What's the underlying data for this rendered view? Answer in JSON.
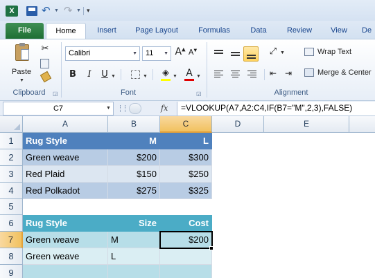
{
  "app": {
    "logo_letter": "X"
  },
  "tabs": [
    "File",
    "Home",
    "Insert",
    "Page Layout",
    "Formulas",
    "Data",
    "Review",
    "View",
    "De"
  ],
  "ribbon": {
    "clipboard": {
      "paste_label": "Paste",
      "group_label": "Clipboard"
    },
    "font": {
      "font_name": "Calibri",
      "font_size": "11",
      "bold": "B",
      "italic": "I",
      "underline": "U",
      "grow": "A",
      "shrink": "A",
      "font_color": "A",
      "group_label": "Font"
    },
    "alignment": {
      "wrap_text": "Wrap Text",
      "merge_center": "Merge & Center",
      "group_label": "Alignment"
    }
  },
  "formula_bar": {
    "name_box": "C7",
    "fx": "fx",
    "formula": "=VLOOKUP(A7,A2:C4,IF(B7=\"M\",2,3),FALSE)"
  },
  "sheet": {
    "columns": [
      "A",
      "B",
      "C",
      "D",
      "E"
    ],
    "selected_column": "C",
    "rows": [
      "1",
      "2",
      "3",
      "4",
      "5",
      "6",
      "7",
      "8",
      "9"
    ],
    "selected_row": "7",
    "table1": {
      "headers": [
        "Rug Style",
        "M",
        "L"
      ],
      "rows": [
        [
          "Green weave",
          "$200",
          "$300"
        ],
        [
          "Red Plaid",
          "$150",
          "$250"
        ],
        [
          "Red Polkadot",
          "$275",
          "$325"
        ]
      ]
    },
    "table2": {
      "headers": [
        "Rug Style",
        "Size",
        "Cost"
      ],
      "rows": [
        [
          "Green weave",
          "M",
          "$200"
        ],
        [
          "Green weave",
          "L",
          ""
        ]
      ]
    }
  },
  "colors": {
    "table1_header": "#4f81bd",
    "table2_header": "#4bacc6",
    "selection": "#f1c15f",
    "file_tab": "#1e6f34"
  }
}
